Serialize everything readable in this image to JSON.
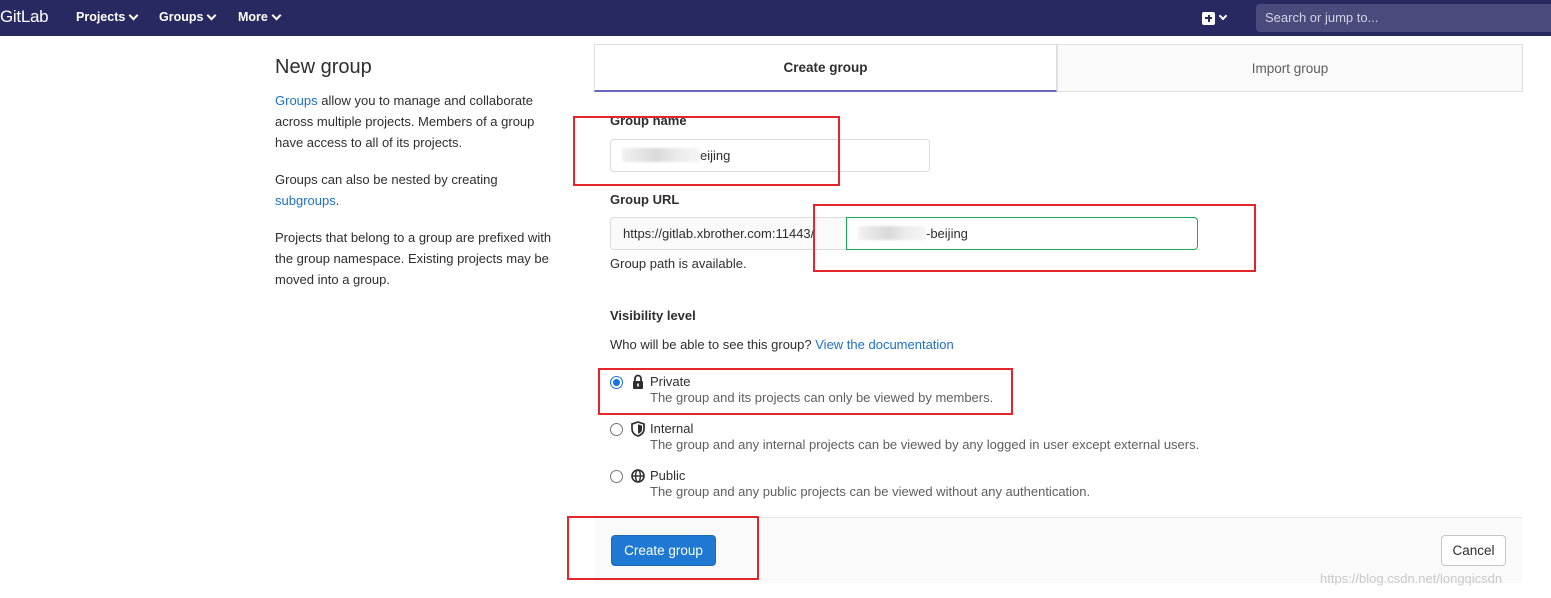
{
  "navbar": {
    "brand": "GitLab",
    "items": [
      {
        "label": "Projects"
      },
      {
        "label": "Groups"
      },
      {
        "label": "More"
      }
    ],
    "search_placeholder": "Search or jump to..."
  },
  "left": {
    "title": "New group",
    "p1_link": "Groups",
    "p1_text": " allow you to manage and collaborate across multiple projects. Members of a group have access to all of its projects.",
    "p2_text": "Groups can also be nested by creating ",
    "p2_link": "subgroups",
    "p2_end": ".",
    "p3_text": "Projects that belong to a group are prefixed with the group namespace. Existing projects may be moved into a group."
  },
  "tabs": {
    "create": "Create group",
    "import": "Import group"
  },
  "form": {
    "group_name_label": "Group name",
    "group_name_value": "eijing",
    "group_url_label": "Group URL",
    "url_prefix": "https://gitlab.xbrother.com:11443/",
    "url_value": "-beijing",
    "url_helper": "Group path is available.",
    "visibility_label": "Visibility level",
    "visibility_question": "Who will be able to see this group?",
    "visibility_link": "View the documentation",
    "visibility": [
      {
        "title": "Private",
        "desc": "The group and its projects can only be viewed by members.",
        "icon": "lock-icon",
        "checked": true
      },
      {
        "title": "Internal",
        "desc": "The group and any internal projects can be viewed by any logged in user except external users.",
        "icon": "shield-icon",
        "checked": false
      },
      {
        "title": "Public",
        "desc": "The group and any public projects can be viewed without any authentication.",
        "icon": "globe-icon",
        "checked": false
      }
    ]
  },
  "actions": {
    "create": "Create group",
    "cancel": "Cancel"
  },
  "watermark": "https://blog.csdn.net/longqicsdn",
  "colors": {
    "navbar": "#292961",
    "primary": "#1f78d1",
    "annotation": "#e3262b",
    "link": "#1f6fc5"
  }
}
